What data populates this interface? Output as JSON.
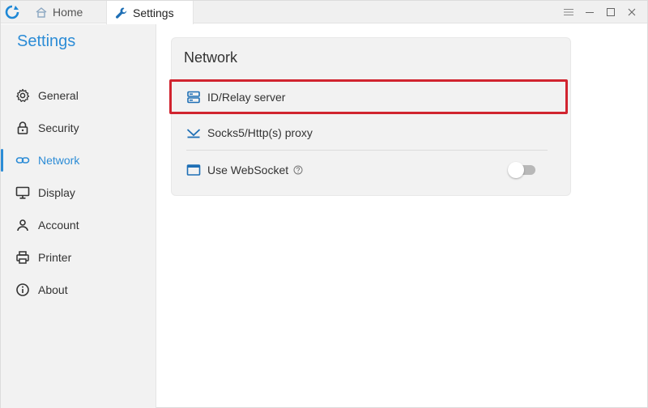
{
  "colors": {
    "accent": "#2c8cd6",
    "highlight": "#d1242f",
    "sidebar_bg": "#f2f2f2",
    "card_bg": "#f2f2f2"
  },
  "titlebar": {
    "tabs": [
      {
        "label": "Home",
        "icon": "home-icon"
      },
      {
        "label": "Settings",
        "icon": "wrench-icon"
      }
    ],
    "controls": [
      "menu-icon",
      "minimize-icon",
      "maximize-icon",
      "close-icon"
    ]
  },
  "sidebar": {
    "title": "Settings",
    "items": [
      {
        "label": "General",
        "icon": "gear-icon"
      },
      {
        "label": "Security",
        "icon": "lock-icon"
      },
      {
        "label": "Network",
        "icon": "link-icon",
        "active": true
      },
      {
        "label": "Display",
        "icon": "monitor-icon"
      },
      {
        "label": "Account",
        "icon": "person-icon"
      },
      {
        "label": "Printer",
        "icon": "printer-icon"
      },
      {
        "label": "About",
        "icon": "info-icon"
      }
    ]
  },
  "network": {
    "title": "Network",
    "rows": [
      {
        "label": "ID/Relay server",
        "icon": "server-icon"
      },
      {
        "label": "Socks5/Http(s) proxy",
        "icon": "proxy-icon"
      },
      {
        "label": "Use WebSocket",
        "icon": "window-icon",
        "toggle": false
      }
    ]
  }
}
